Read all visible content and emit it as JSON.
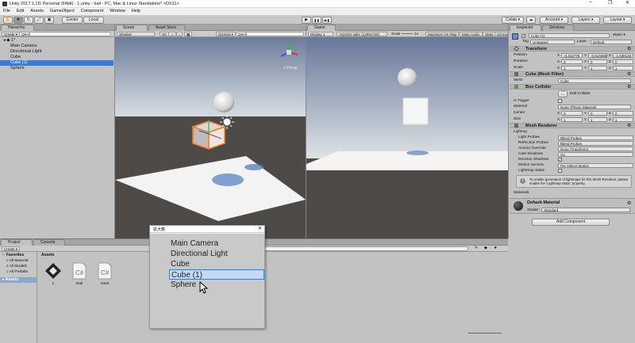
{
  "window": {
    "title": "Unity 2017.1.1f1 Personal (64bit) - 1.unity - ball - PC, Mac & Linux Standalone* <DX11>",
    "controls": [
      "–",
      "❐",
      "✕"
    ]
  },
  "menu": [
    "File",
    "Edit",
    "Assets",
    "GameObject",
    "Component",
    "Window",
    "Help"
  ],
  "toolbar": {
    "pivot": "Center",
    "space": "Local",
    "play": "▶",
    "pause": "❚❚",
    "step": "▶❚",
    "collab": "Collab ▾",
    "cloud": "☁",
    "account": "Account ▾",
    "layers": "Layers ▾",
    "layout": "Layout ▾"
  },
  "hierarchy": {
    "tab": "Hierarchy",
    "create": "Create ▾",
    "search_placeholder": "Q▾All",
    "scene": "1*",
    "items": [
      "Main Camera",
      "Directional Light",
      "Cube",
      "Cube (1)",
      "Sphere"
    ],
    "selected_index": 3
  },
  "scene": {
    "tab": "Scene",
    "asset_store_tab": "Asset Store",
    "shading": "Shaded",
    "mode_2d": "2D",
    "gizmos": "Gizmos ▾",
    "search_placeholder": "Q▾All",
    "persp": "< Persp"
  },
  "game": {
    "tab": "Game",
    "display": "Display 1",
    "aspect": "AQUOS sabc (1280x720)",
    "scale_label": "Scale",
    "scale_value": "1x",
    "maximize": "Maximize On Play",
    "mute": "Mute Audio",
    "stats": "Stats",
    "gizmos": "Gizmos ▾"
  },
  "inspector": {
    "tab": "Inspector",
    "services_tab": "Services",
    "object_name": "Cube (1)",
    "static_label": "Static ▾",
    "tag_label": "Tag",
    "tag_value": "Untagged",
    "layer_label": "Layer",
    "layer_value": "Default",
    "transform": {
      "title": "Transform",
      "position_label": "Position",
      "position": [
        "-0.342775",
        "-0.6103652",
        "-1.636133"
      ],
      "rotation_label": "Rotation",
      "rotation": [
        "0",
        "0",
        "0"
      ],
      "scale_label": "Scale",
      "scale": [
        "1",
        "1",
        "1"
      ]
    },
    "mesh_filter": {
      "title": "Cube (Mesh Filter)",
      "mesh_label": "Mesh",
      "mesh_value": "Cube"
    },
    "box_collider": {
      "title": "Box Collider",
      "edit_label": "Edit Collider",
      "is_trigger_label": "Is Trigger",
      "material_label": "Material",
      "material_value": "None (Physic Material)",
      "center_label": "Center",
      "center": [
        "0",
        "0",
        "0"
      ],
      "size_label": "Size",
      "size": [
        "1",
        "1",
        "1"
      ]
    },
    "mesh_renderer": {
      "title": "Mesh Renderer",
      "lighting_label": "Lighting",
      "light_probes_label": "Light Probes",
      "light_probes_value": "Blend Probes",
      "reflection_probes_label": "Reflection Probes",
      "reflection_probes_value": "Blend Probes",
      "anchor_label": "Anchor Override",
      "anchor_value": "None (Transform)",
      "cast_shadows_label": "Cast Shadows",
      "cast_shadows_value": "On",
      "receive_shadows_label": "Receive Shadows",
      "motion_vectors_label": "Motion Vectors",
      "motion_vectors_value": "Per Object Motion",
      "lightmap_static_label": "Lightmap Static",
      "info": "To enable generation of lightmaps for this Mesh Renderer, please enable the 'Lightmap Static' property.",
      "materials_label": "Materials"
    },
    "material": {
      "name": "Default-Material",
      "shader_label": "Shader",
      "shader_value": "Standard"
    },
    "add_component": "Add Component"
  },
  "project": {
    "tab": "Project",
    "console_tab": "Console",
    "create": "Create ▾",
    "favorites": "Favorites",
    "fav_items": [
      "All Material",
      "All Models",
      "All Prefabs"
    ],
    "assets_label": "Assets",
    "assets_header": "Assets",
    "files": [
      {
        "name": "1",
        "icon": "unity-scene-icon"
      },
      {
        "name": "Ball",
        "icon": "csharp-script-icon"
      },
      {
        "name": "reset",
        "icon": "csharp-script-icon"
      }
    ]
  },
  "magnifier": {
    "title": "拡大鏡",
    "items": [
      "Main Camera",
      "Directional Light",
      "Cube",
      "Cube (1)",
      "Sphere"
    ],
    "selected_index": 3
  },
  "colors": {
    "selection": "#3d7bd1",
    "selection_light": "#c6d9f4",
    "sky_top": "#6d7d9a",
    "ground": "#4d4a47"
  }
}
